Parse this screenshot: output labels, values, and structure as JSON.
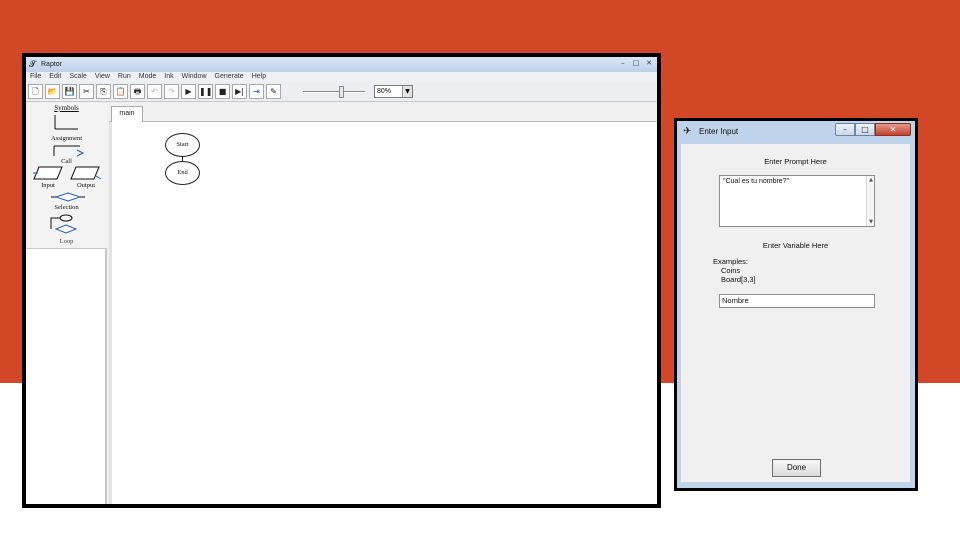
{
  "raptor": {
    "title": "Raptor",
    "window_buttons": {
      "min": "–",
      "max": "□",
      "close": "✕"
    },
    "menu": [
      "File",
      "Edit",
      "Scale",
      "View",
      "Run",
      "Mode",
      "Ink",
      "Window",
      "Generate",
      "Help"
    ],
    "toolbar_icons": [
      "new-icon",
      "open-icon",
      "save-icon",
      "cut-icon",
      "copy-icon",
      "paste-icon",
      "print-icon",
      "undo-icon",
      "redo-icon",
      "play-icon",
      "pause-icon",
      "stop-icon",
      "step-icon",
      "step-into-icon",
      "pen-icon"
    ],
    "toolbar_glyphs": [
      "🗋",
      "📂",
      "💾",
      "✂",
      "⎘",
      "📋",
      "🖶",
      "↶",
      "↷",
      "▶",
      "❚❚",
      "■",
      "▶|",
      "⇥",
      "✎"
    ],
    "zoom": {
      "value": "80%",
      "level": 0.62
    },
    "symbols": {
      "heading": "Symbols",
      "assignment": "Assignment",
      "call": "Call",
      "input": "Input",
      "output": "Output",
      "selection": "Selection",
      "loop": "Loop"
    },
    "tab": "main",
    "flow": {
      "start": "Start",
      "end": "End"
    }
  },
  "dialog": {
    "title": "Enter Input",
    "prompt_label": "Enter Prompt Here",
    "prompt_value": "\"Cual es tu nombre?\"",
    "variable_label": "Enter Variable Here",
    "examples_label": "Examples:",
    "example_1": "Coins",
    "example_2": "Board[3,3]",
    "variable_value": "Nombre",
    "done_label": "Done"
  },
  "colors": {
    "background_accent": "#d24726"
  }
}
